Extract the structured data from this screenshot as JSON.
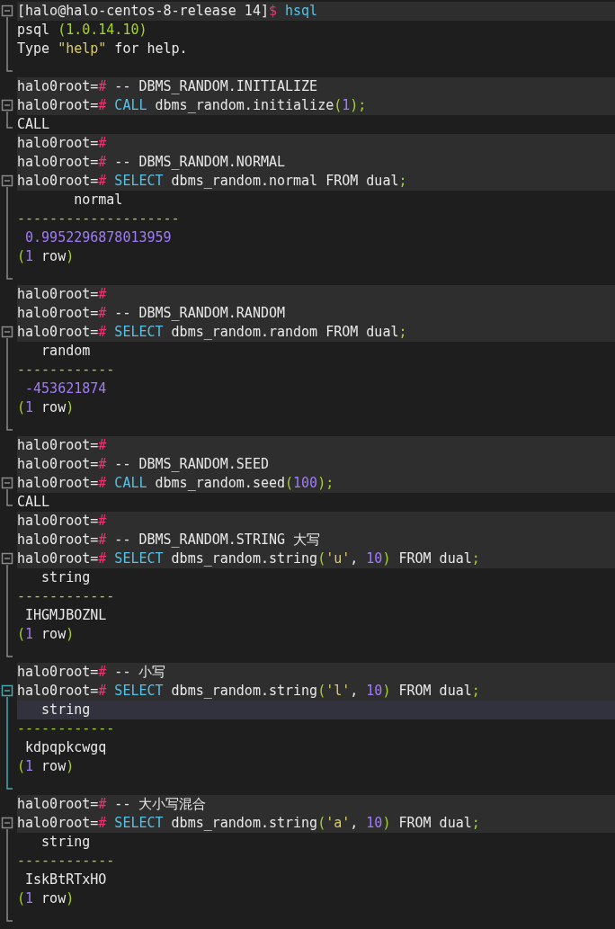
{
  "lines": [
    {
      "highlighted": true,
      "selected": false,
      "tokens": [
        {
          "kind": "plain",
          "text": "[halo@halo-centos-8-release 14]"
        },
        {
          "kind": "sign",
          "text": "$"
        },
        {
          "kind": "keyword",
          "text": " hsql"
        }
      ],
      "children": [
        {
          "highlighted": false,
          "selected": false,
          "tokens": [
            {
              "kind": "plain",
              "text": "psql "
            },
            {
              "kind": "paren",
              "text": "(1.0.14.10)"
            }
          ]
        },
        {
          "highlighted": false,
          "selected": false,
          "tokens": [
            {
              "kind": "plain",
              "text": "Type "
            },
            {
              "kind": "string",
              "text": "\"help\""
            },
            {
              "kind": "plain",
              "text": " for help."
            }
          ]
        },
        {
          "highlighted": false,
          "selected": false
        }
      ]
    },
    {
      "highlighted": true,
      "selected": false,
      "tokens": [
        {
          "kind": "plain",
          "text": "halo0root="
        },
        {
          "kind": "sign",
          "text": "#"
        },
        {
          "kind": "plain",
          "text": " -- DBMS_RANDOM.INITIALIZE"
        }
      ]
    },
    {
      "highlighted": true,
      "selected": false,
      "tokens": [
        {
          "kind": "plain",
          "text": "halo0root="
        },
        {
          "kind": "sign",
          "text": "#"
        },
        {
          "kind": "keyword",
          "text": " CALL"
        },
        {
          "kind": "plain",
          "text": " dbms_random.initialize"
        },
        {
          "kind": "paren",
          "text": "("
        },
        {
          "kind": "number",
          "text": "1"
        },
        {
          "kind": "paren",
          "text": ");"
        }
      ],
      "children": [
        {
          "highlighted": false,
          "selected": false,
          "tokens": [
            {
              "kind": "plain",
              "text": "CALL"
            }
          ]
        }
      ]
    },
    {
      "highlighted": true,
      "selected": false,
      "tokens": [
        {
          "kind": "plain",
          "text": "halo0root="
        },
        {
          "kind": "sign",
          "text": "#"
        }
      ]
    },
    {
      "highlighted": true,
      "selected": false,
      "tokens": [
        {
          "kind": "plain",
          "text": "halo0root="
        },
        {
          "kind": "sign",
          "text": "#"
        },
        {
          "kind": "plain",
          "text": " -- DBMS_RANDOM.NORMAL"
        }
      ]
    },
    {
      "highlighted": true,
      "selected": false,
      "tokens": [
        {
          "kind": "plain",
          "text": "halo0root="
        },
        {
          "kind": "sign",
          "text": "#"
        },
        {
          "kind": "keyword",
          "text": " SELECT"
        },
        {
          "kind": "plain",
          "text": " dbms_random.normal FROM dual"
        },
        {
          "kind": "paren",
          "text": ";"
        }
      ],
      "children": [
        {
          "highlighted": false,
          "selected": false,
          "tokens": [
            {
              "kind": "plain",
              "text": "       normal"
            }
          ]
        },
        {
          "highlighted": false,
          "selected": false,
          "tokens": [
            {
              "kind": "paren",
              "text": "--------------------"
            }
          ]
        },
        {
          "highlighted": false,
          "selected": false,
          "tokens": [
            {
              "kind": "number",
              "text": " 0.9952296878013959"
            }
          ]
        },
        {
          "highlighted": false,
          "selected": false,
          "tokens": [
            {
              "kind": "paren",
              "text": "("
            },
            {
              "kind": "number",
              "text": "1"
            },
            {
              "kind": "plain",
              "text": " row"
            },
            {
              "kind": "paren",
              "text": ")"
            }
          ]
        },
        {
          "highlighted": false,
          "selected": false
        }
      ]
    },
    {
      "highlighted": true,
      "selected": false,
      "tokens": [
        {
          "kind": "plain",
          "text": "halo0root="
        },
        {
          "kind": "sign",
          "text": "#"
        }
      ]
    },
    {
      "highlighted": true,
      "selected": false,
      "tokens": [
        {
          "kind": "plain",
          "text": "halo0root="
        },
        {
          "kind": "sign",
          "text": "#"
        },
        {
          "kind": "plain",
          "text": " -- DBMS_RANDOM.RANDOM"
        }
      ]
    },
    {
      "highlighted": true,
      "selected": false,
      "tokens": [
        {
          "kind": "plain",
          "text": "halo0root="
        },
        {
          "kind": "sign",
          "text": "#"
        },
        {
          "kind": "keyword",
          "text": " SELECT"
        },
        {
          "kind": "plain",
          "text": " dbms_random.random FROM dual"
        },
        {
          "kind": "paren",
          "text": ";"
        }
      ],
      "children": [
        {
          "highlighted": false,
          "selected": false,
          "tokens": [
            {
              "kind": "plain",
              "text": "   random"
            }
          ]
        },
        {
          "highlighted": false,
          "selected": false,
          "tokens": [
            {
              "kind": "paren",
              "text": "------------"
            }
          ]
        },
        {
          "highlighted": false,
          "selected": false,
          "tokens": [
            {
              "kind": "number",
              "text": " -453621874"
            }
          ]
        },
        {
          "highlighted": false,
          "selected": false,
          "tokens": [
            {
              "kind": "paren",
              "text": "("
            },
            {
              "kind": "number",
              "text": "1"
            },
            {
              "kind": "plain",
              "text": " row"
            },
            {
              "kind": "paren",
              "text": ")"
            }
          ]
        },
        {
          "highlighted": false,
          "selected": false
        }
      ]
    },
    {
      "highlighted": true,
      "selected": false,
      "tokens": [
        {
          "kind": "plain",
          "text": "halo0root="
        },
        {
          "kind": "sign",
          "text": "#"
        }
      ]
    },
    {
      "highlighted": true,
      "selected": false,
      "tokens": [
        {
          "kind": "plain",
          "text": "halo0root="
        },
        {
          "kind": "sign",
          "text": "#"
        },
        {
          "kind": "plain",
          "text": " -- DBMS_RANDOM.SEED"
        }
      ]
    },
    {
      "highlighted": true,
      "selected": false,
      "tokens": [
        {
          "kind": "plain",
          "text": "halo0root="
        },
        {
          "kind": "sign",
          "text": "#"
        },
        {
          "kind": "keyword",
          "text": " CALL"
        },
        {
          "kind": "plain",
          "text": " dbms_random.seed"
        },
        {
          "kind": "paren",
          "text": "("
        },
        {
          "kind": "number",
          "text": "100"
        },
        {
          "kind": "paren",
          "text": ");"
        }
      ],
      "children": [
        {
          "highlighted": false,
          "selected": false,
          "tokens": [
            {
              "kind": "plain",
              "text": "CALL"
            }
          ]
        }
      ]
    },
    {
      "highlighted": true,
      "selected": false,
      "tokens": [
        {
          "kind": "plain",
          "text": "halo0root="
        },
        {
          "kind": "sign",
          "text": "#"
        }
      ]
    },
    {
      "highlighted": true,
      "selected": false,
      "tokens": [
        {
          "kind": "plain",
          "text": "halo0root="
        },
        {
          "kind": "sign",
          "text": "#"
        },
        {
          "kind": "plain",
          "text": " -- DBMS_RANDOM.STRING 大写"
        }
      ]
    },
    {
      "highlighted": true,
      "selected": false,
      "tokens": [
        {
          "kind": "plain",
          "text": "halo0root="
        },
        {
          "kind": "sign",
          "text": "#"
        },
        {
          "kind": "keyword",
          "text": " SELECT"
        },
        {
          "kind": "plain",
          "text": " dbms_random.string"
        },
        {
          "kind": "paren",
          "text": "("
        },
        {
          "kind": "string",
          "text": "'u'"
        },
        {
          "kind": "plain",
          "text": ", "
        },
        {
          "kind": "number",
          "text": "10"
        },
        {
          "kind": "paren",
          "text": ")"
        },
        {
          "kind": "plain",
          "text": " FROM dual"
        },
        {
          "kind": "paren",
          "text": ";"
        }
      ],
      "children": [
        {
          "highlighted": false,
          "selected": false,
          "tokens": [
            {
              "kind": "plain",
              "text": "   string"
            }
          ]
        },
        {
          "highlighted": false,
          "selected": false,
          "tokens": [
            {
              "kind": "paren",
              "text": "------------"
            }
          ]
        },
        {
          "highlighted": false,
          "selected": false,
          "tokens": [
            {
              "kind": "plain",
              "text": " IHGMJBOZNL"
            }
          ]
        },
        {
          "highlighted": false,
          "selected": false,
          "tokens": [
            {
              "kind": "paren",
              "text": "("
            },
            {
              "kind": "number",
              "text": "1"
            },
            {
              "kind": "plain",
              "text": " row"
            },
            {
              "kind": "paren",
              "text": ")"
            }
          ]
        },
        {
          "highlighted": false,
          "selected": false
        }
      ]
    },
    {
      "highlighted": true,
      "selected": false,
      "tokens": [
        {
          "kind": "plain",
          "text": "halo0root="
        },
        {
          "kind": "sign",
          "text": "#"
        },
        {
          "kind": "plain",
          "text": " -- 小写"
        }
      ]
    },
    {
      "highlighted": true,
      "selected": false,
      "tokens": [
        {
          "kind": "plain",
          "text": "halo0root="
        },
        {
          "kind": "sign",
          "text": "#"
        },
        {
          "kind": "keyword",
          "text": " SELECT"
        },
        {
          "kind": "plain",
          "text": " dbms_random.string"
        },
        {
          "kind": "paren",
          "text": "("
        },
        {
          "kind": "string",
          "text": "'l'"
        },
        {
          "kind": "plain",
          "text": ", "
        },
        {
          "kind": "number",
          "text": "10"
        },
        {
          "kind": "paren",
          "text": ")"
        },
        {
          "kind": "plain",
          "text": " FROM dual"
        },
        {
          "kind": "paren",
          "text": ";"
        }
      ],
      "children": [
        {
          "highlighted": false,
          "selected": true,
          "tokens": [
            {
              "kind": "plain",
              "text": "   string"
            }
          ]
        },
        {
          "highlighted": false,
          "selected": false,
          "tokens": [
            {
              "kind": "paren",
              "text": "------------"
            }
          ]
        },
        {
          "highlighted": false,
          "selected": false,
          "tokens": [
            {
              "kind": "plain",
              "text": " kdpqpkcwgq"
            }
          ]
        },
        {
          "highlighted": false,
          "selected": false,
          "tokens": [
            {
              "kind": "paren",
              "text": "("
            },
            {
              "kind": "number",
              "text": "1"
            },
            {
              "kind": "plain",
              "text": " row"
            },
            {
              "kind": "paren",
              "text": ")"
            }
          ]
        },
        {
          "highlighted": false,
          "selected": false
        }
      ]
    },
    {
      "highlighted": true,
      "selected": false,
      "tokens": [
        {
          "kind": "plain",
          "text": "halo0root="
        },
        {
          "kind": "sign",
          "text": "#"
        },
        {
          "kind": "plain",
          "text": " -- 大小写混合"
        }
      ]
    },
    {
      "highlighted": true,
      "selected": false,
      "tokens": [
        {
          "kind": "plain",
          "text": "halo0root="
        },
        {
          "kind": "sign",
          "text": "#"
        },
        {
          "kind": "keyword",
          "text": " SELECT"
        },
        {
          "kind": "plain",
          "text": " dbms_random.string"
        },
        {
          "kind": "paren",
          "text": "("
        },
        {
          "kind": "string",
          "text": "'a'"
        },
        {
          "kind": "plain",
          "text": ", "
        },
        {
          "kind": "number",
          "text": "10"
        },
        {
          "kind": "paren",
          "text": ")"
        },
        {
          "kind": "plain",
          "text": " FROM dual"
        },
        {
          "kind": "paren",
          "text": ";"
        }
      ],
      "children": [
        {
          "highlighted": false,
          "selected": false,
          "tokens": [
            {
              "kind": "plain",
              "text": "   string"
            }
          ]
        },
        {
          "highlighted": false,
          "selected": false,
          "tokens": [
            {
              "kind": "paren",
              "text": "------------"
            }
          ]
        },
        {
          "highlighted": false,
          "selected": false,
          "tokens": [
            {
              "kind": "plain",
              "text": " IskBtRTxHO"
            }
          ]
        },
        {
          "highlighted": false,
          "selected": false,
          "tokens": [
            {
              "kind": "paren",
              "text": "("
            },
            {
              "kind": "number",
              "text": "1"
            },
            {
              "kind": "plain",
              "text": " row"
            },
            {
              "kind": "paren",
              "text": ")"
            }
          ]
        },
        {
          "highlighted": false,
          "selected": false
        }
      ]
    }
  ]
}
